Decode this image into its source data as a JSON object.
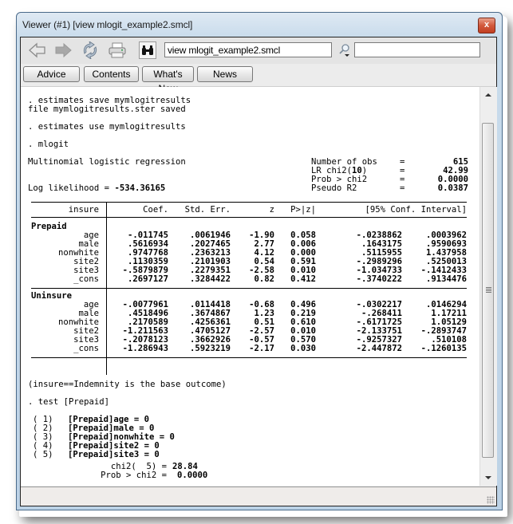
{
  "window": {
    "title": "Viewer (#1) [view mlogit_example2.smcl]",
    "close_label": "x"
  },
  "toolbar": {
    "icons": [
      "back-arrow-icon",
      "forward-arrow-icon",
      "refresh-icon",
      "print-icon",
      "find-binoculars-icon",
      "search-magnifier-icon"
    ],
    "address_value": "view mlogit_example2.smcl",
    "search_value": ""
  },
  "nav_buttons": [
    {
      "label": "Advice"
    },
    {
      "label": "Contents"
    },
    {
      "label": "What's New"
    },
    {
      "label": "News"
    }
  ],
  "output": {
    "cmd1": ". estimates save mymlogitresults",
    "msg1": "file mymlogitresults.ster saved",
    "cmd2": ". estimates use mymlogitresults",
    "cmd3": ". mlogit",
    "model_title": "Multinomial logistic regression",
    "loglik_label": "Log likelihood = ",
    "loglik_value": "-534.36165",
    "stats": [
      {
        "label": "Number of obs",
        "eq": "=",
        "value": "615"
      },
      {
        "label": "LR chi2(",
        "label_bold": "10",
        "label_end": ")",
        "eq": "=",
        "value": "42.99"
      },
      {
        "label": "Prob > chi2",
        "eq": "=",
        "value": "0.0000"
      },
      {
        "label": "Pseudo R2",
        "eq": "=",
        "value": "0.0387"
      }
    ],
    "table": {
      "depvar": "insure",
      "headers": [
        "Coef.",
        "Std. Err.",
        "z",
        "P>|z|",
        "[95% Conf. Interval]"
      ],
      "groups": [
        {
          "name": "Prepaid",
          "rows": [
            {
              "var": "age",
              "coef": "-.011745",
              "se": ".0061946",
              "z": "-1.90",
              "p": "0.058",
              "lo": "-.0238862",
              "hi": ".0003962"
            },
            {
              "var": "male",
              "coef": ".5616934",
              "se": ".2027465",
              "z": "2.77",
              "p": "0.006",
              "lo": ".1643175",
              "hi": ".9590693"
            },
            {
              "var": "nonwhite",
              "coef": ".9747768",
              "se": ".2363213",
              "z": "4.12",
              "p": "0.000",
              "lo": ".5115955",
              "hi": "1.437958"
            },
            {
              "var": "site2",
              "coef": ".1130359",
              "se": ".2101903",
              "z": "0.54",
              "p": "0.591",
              "lo": "-.2989296",
              "hi": ".5250013"
            },
            {
              "var": "site3",
              "coef": "-.5879879",
              "se": ".2279351",
              "z": "-2.58",
              "p": "0.010",
              "lo": "-1.034733",
              "hi": "-.1412433"
            },
            {
              "var": "_cons",
              "coef": ".2697127",
              "se": ".3284422",
              "z": "0.82",
              "p": "0.412",
              "lo": "-.3740222",
              "hi": ".9134476"
            }
          ]
        },
        {
          "name": "Uninsure",
          "rows": [
            {
              "var": "age",
              "coef": "-.0077961",
              "se": ".0114418",
              "z": "-0.68",
              "p": "0.496",
              "lo": "-.0302217",
              "hi": ".0146294"
            },
            {
              "var": "male",
              "coef": ".4518496",
              "se": ".3674867",
              "z": "1.23",
              "p": "0.219",
              "lo": "-.268411",
              "hi": "1.17211"
            },
            {
              "var": "nonwhite",
              "coef": ".2170589",
              "se": ".4256361",
              "z": "0.51",
              "p": "0.610",
              "lo": "-.6171725",
              "hi": "1.05129"
            },
            {
              "var": "site2",
              "coef": "-1.211563",
              "se": ".4705127",
              "z": "-2.57",
              "p": "0.010",
              "lo": "-2.133751",
              "hi": "-.2893747"
            },
            {
              "var": "site3",
              "coef": "-.2078123",
              "se": ".3662926",
              "z": "-0.57",
              "p": "0.570",
              "lo": "-.9257327",
              "hi": ".510108"
            },
            {
              "var": "_cons",
              "coef": "-1.286943",
              "se": ".5923219",
              "z": "-2.17",
              "p": "0.030",
              "lo": "-2.447872",
              "hi": "-.1260135"
            }
          ]
        }
      ]
    },
    "base_note": "(insure==Indemnity is the base outcome)",
    "cmd4": ". test [Prepaid]",
    "constraints": [
      {
        "num": "( 1)",
        "text": "[Prepaid]age = 0"
      },
      {
        "num": "( 2)",
        "text": "[Prepaid]male = 0"
      },
      {
        "num": "( 3)",
        "text": "[Prepaid]nonwhite = 0"
      },
      {
        "num": "( 4)",
        "text": "[Prepaid]site2 = 0"
      },
      {
        "num": "( 5)",
        "text": "[Prepaid]site3 = 0"
      }
    ],
    "chi2_label": "chi2(  5) =",
    "chi2_value": "28.84",
    "prob_label": "Prob > chi2 =",
    "prob_value": "0.0000"
  },
  "status_text": ""
}
